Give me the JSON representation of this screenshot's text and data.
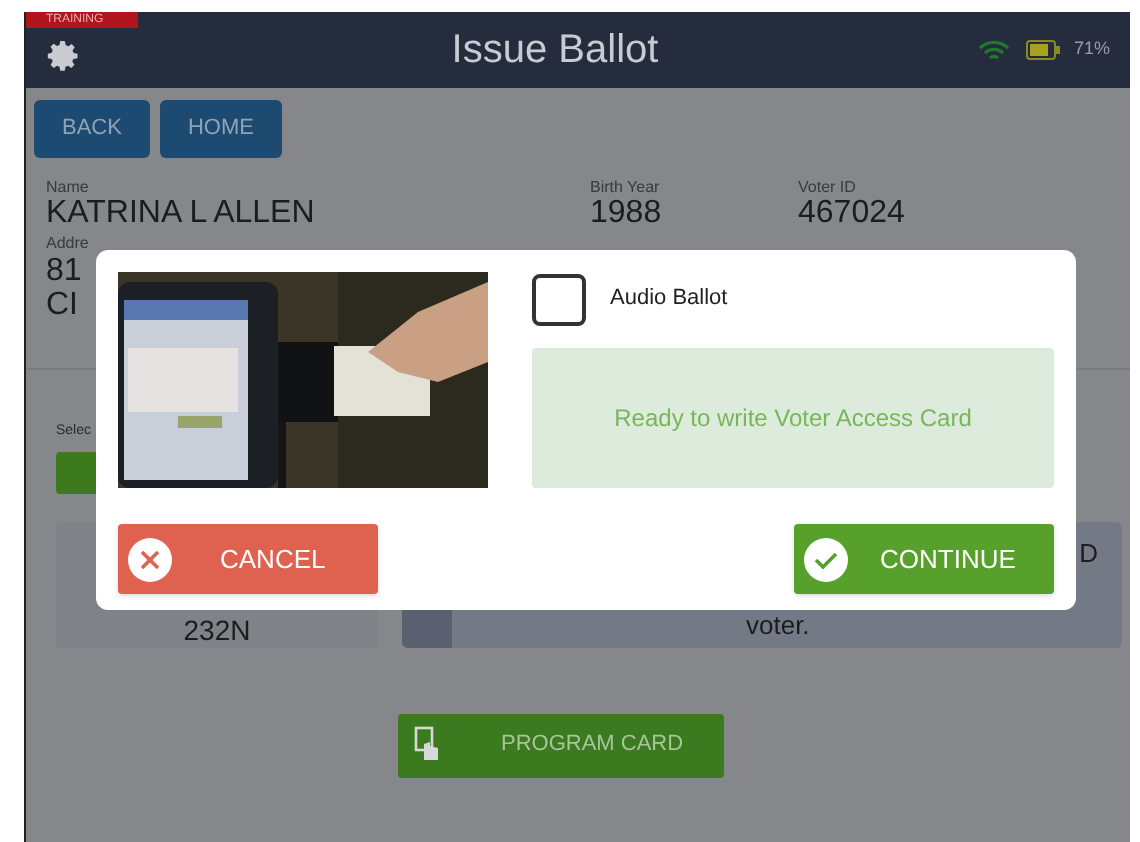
{
  "header": {
    "training_badge": "TRAINING",
    "title": "Issue Ballot",
    "battery_reading": "71%"
  },
  "nav_buttons": [
    "BACK",
    "HOME"
  ],
  "voter": {
    "name_label": "Name",
    "name": "KATRINA L ALLEN",
    "birth_year_label": "Birth Year",
    "birth_year": "1988",
    "voter_id_label": "Voter ID",
    "voter_id": "467024",
    "address_label": "Addre",
    "address_line_1": "81",
    "address_line_2": "CI"
  },
  "select_label": "Selec",
  "precinct_card": {
    "value": "232N"
  },
  "message_card": {
    "text": "voter.",
    "edge_text": "D"
  },
  "program_card_button": "PROGRAM CARD",
  "dialog": {
    "audio_ballot": {
      "label": "Audio Ballot",
      "checked": false
    },
    "status": "Ready to write Voter Access Card",
    "cancel": "CANCEL",
    "continue": "CONTINUE"
  }
}
